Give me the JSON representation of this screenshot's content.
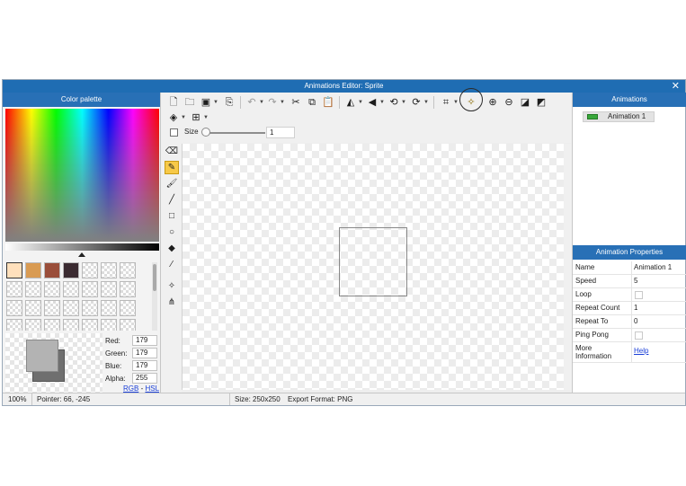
{
  "window": {
    "title": "Animations Editor: Sprite",
    "close_glyph": "✕"
  },
  "color_palette": {
    "header": "Color palette",
    "swatches": [
      "#ffe0bc",
      "#d99b52",
      "#9a4e3a",
      "#3b2b31"
    ],
    "selected_color": "#b3b3b3",
    "secondary_color": "#6f6f6f",
    "components": [
      {
        "label": "Red:",
        "value": "179"
      },
      {
        "label": "Green:",
        "value": "179"
      },
      {
        "label": "Blue:",
        "value": "179"
      },
      {
        "label": "Alpha:",
        "value": "255"
      }
    ],
    "mode_rgb": "RGB",
    "mode_sep": " - ",
    "mode_hsl": "HSL"
  },
  "toolbar": {
    "icons": [
      "new-file-icon",
      "open-folder-icon",
      "save-icon",
      "export-icon",
      "undo-icon",
      "redo-icon",
      "cut-icon",
      "copy-icon",
      "paste-icon",
      "flip-horizontal-icon",
      "flip-vertical-icon",
      "rotate-left-icon",
      "rotate-right-icon",
      "crop-icon",
      "optimize-icon",
      "zoom-in-icon",
      "zoom-out-icon",
      "fit-icon",
      "layers-icon",
      "grid-icon"
    ],
    "size_label": "Size",
    "size_value": "1",
    "size_fraction": 0.0
  },
  "tools": [
    "eraser-icon",
    "pencil-icon",
    "brush-icon",
    "line-icon",
    "rectangle-icon",
    "ellipse-icon",
    "fill-bucket-icon",
    "eyedropper-icon",
    "pivot-icon",
    "anchor-points-icon"
  ],
  "active_tool": "pencil-icon",
  "animations": {
    "header": "Animations",
    "items": [
      {
        "label": "Animation 1"
      }
    ]
  },
  "properties": {
    "header": "Animation Properties",
    "rows": [
      {
        "key": "Name",
        "value": "Animation 1"
      },
      {
        "key": "Speed",
        "value": "5"
      },
      {
        "key": "Loop",
        "value": "",
        "checkbox": true,
        "checked": false
      },
      {
        "key": "Repeat Count",
        "value": "1"
      },
      {
        "key": "Repeat To",
        "value": "0"
      },
      {
        "key": "Ping Pong",
        "value": "",
        "checkbox": true,
        "checked": false
      },
      {
        "key_line1": "More",
        "key_line2": "Information",
        "link": "Help"
      }
    ]
  },
  "status": {
    "zoom": "100%",
    "pointer": "Pointer: 66, -245",
    "size": "Size: 250x250",
    "export_format": "Export Format: PNG"
  }
}
